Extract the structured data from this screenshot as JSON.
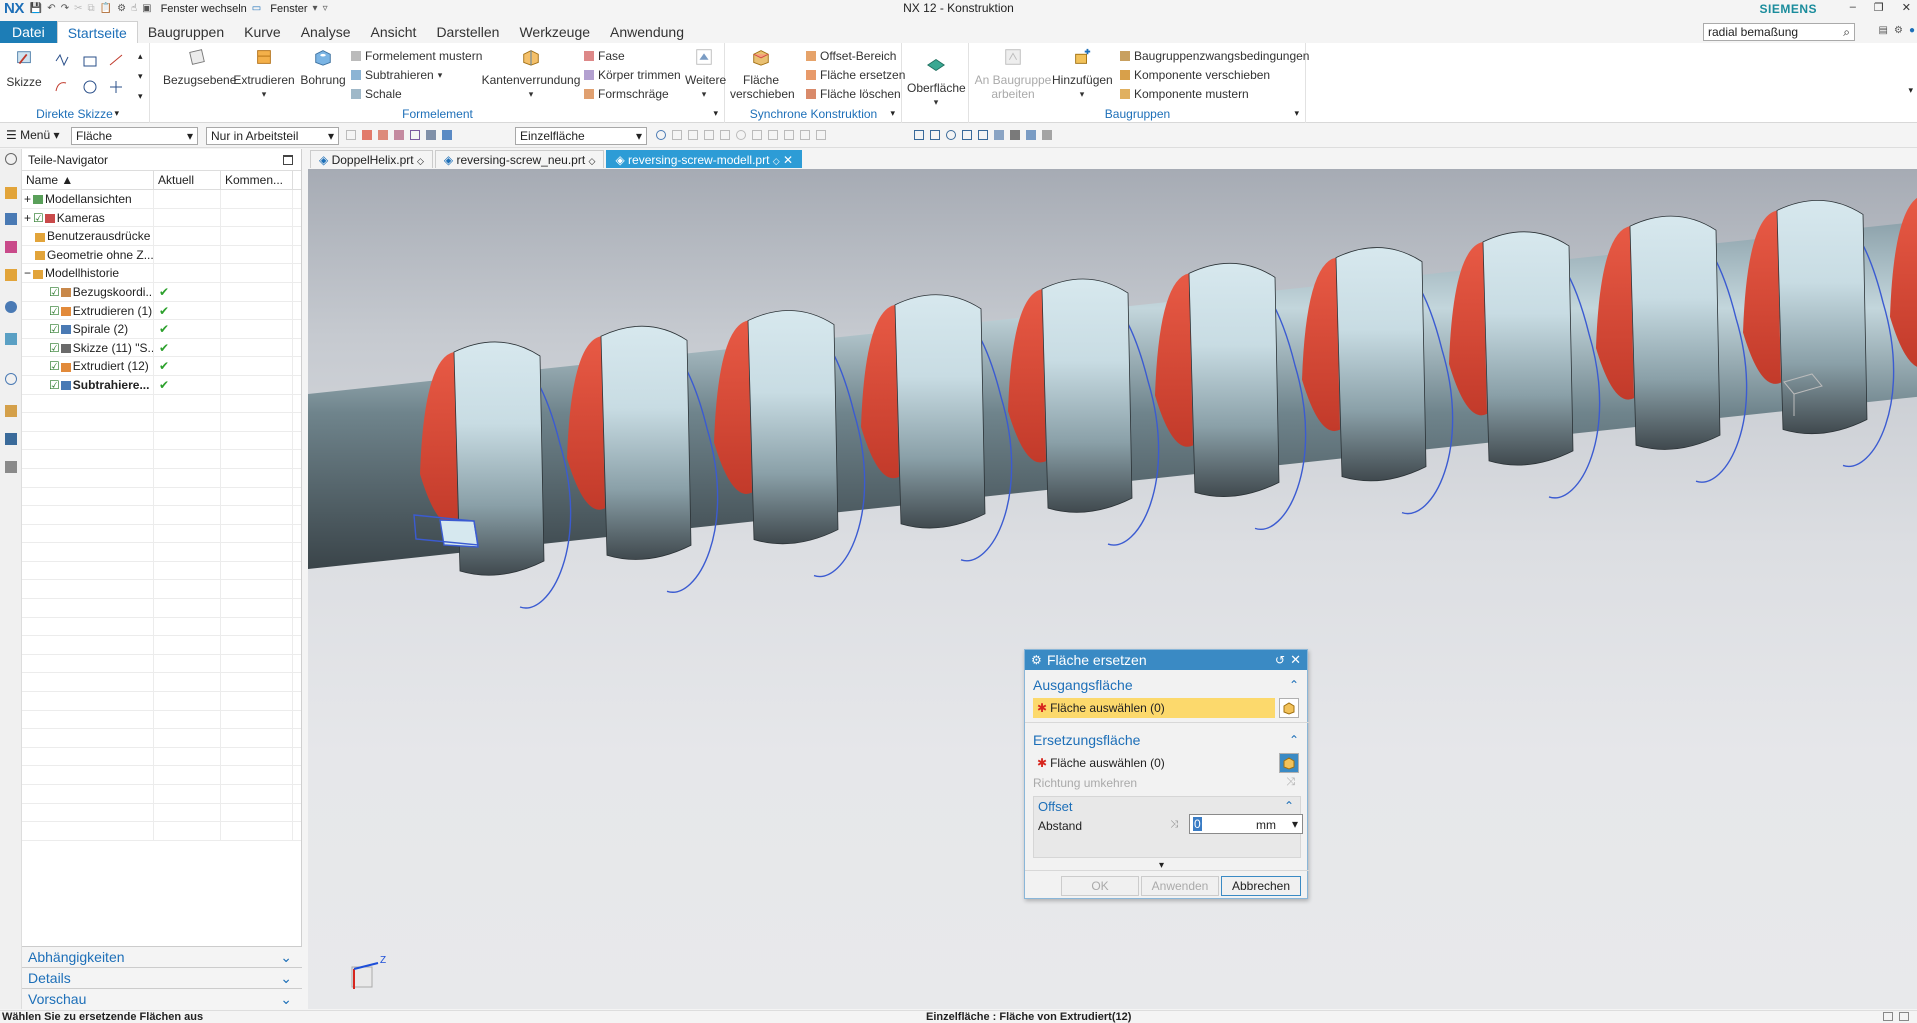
{
  "app": {
    "logo": "NX",
    "window_title": "NX 12 - Konstruktion",
    "brand": "SIEMENS",
    "quick_access": {
      "switch_window": "Fenster wechseln",
      "window": "Fenster"
    },
    "search_value": "radial bemaßung"
  },
  "ribbon_tabs": [
    "Datei",
    "Startseite",
    "Baugruppen",
    "Kurve",
    "Analyse",
    "Ansicht",
    "Darstellen",
    "Werkzeuge",
    "Anwendung"
  ],
  "ribbon": {
    "direct_sketch": {
      "label": "Direkte Skizze",
      "sketch": "Skizze"
    },
    "feature": {
      "label": "Formelement",
      "datum_plane": "Bezugsebene",
      "extrude": "Extrudieren",
      "hole": "Bohrung",
      "pattern": "Formelement mustern",
      "subtract": "Subtrahieren",
      "shell": "Schale",
      "edge_blend": "Kantenverrundung",
      "chamfer": "Fase",
      "trim_body": "Körper trimmen",
      "draft": "Formschräge",
      "more": "Weitere"
    },
    "sync": {
      "label": "Synchrone Konstruktion",
      "move_face_1": "Fläche",
      "move_face_2": "verschieben",
      "offset_region": "Offset-Bereich",
      "replace_face": "Fläche ersetzen",
      "delete_face": "Fläche löschen"
    },
    "surface": {
      "label": "Oberfläche"
    },
    "assemblies": {
      "label": "Baugruppen",
      "work_on_1": "An Baugruppe",
      "work_on_2": "arbeiten",
      "add": "Hinzufügen",
      "constraints": "Baugruppenzwangsbedingungen",
      "move_component": "Komponente verschieben",
      "pattern_component": "Komponente mustern"
    }
  },
  "toolbar": {
    "menu": "Menü",
    "filter_type": "Fläche",
    "scope": "Nur in Arbeitsteil",
    "face_rule": "Einzelfläche"
  },
  "navigator": {
    "title": "Teile-Navigator",
    "columns": [
      "Name",
      "Aktuell",
      "Kommen..."
    ],
    "rows": [
      {
        "label": "Modellansichten",
        "current": ""
      },
      {
        "label": "Kameras",
        "current": ""
      },
      {
        "label": "Benutzerausdrücke",
        "current": ""
      },
      {
        "label": "Geometrie ohne Z...",
        "current": ""
      },
      {
        "label": "Modellhistorie",
        "current": ""
      },
      {
        "label": "Bezugskoordi...",
        "current": "✔"
      },
      {
        "label": "Extrudieren (1)",
        "current": "✔"
      },
      {
        "label": "Spirale (2)",
        "current": "✔"
      },
      {
        "label": "Skizze (11) \"S...",
        "current": "✔"
      },
      {
        "label": "Extrudiert (12)",
        "current": "✔"
      },
      {
        "label": "Subtrahiere...",
        "current": "✔"
      }
    ],
    "panels": [
      "Abhängigkeiten",
      "Details",
      "Vorschau"
    ]
  },
  "doc_tabs": [
    "DoppelHelix.prt",
    "reversing-screw_neu.prt",
    "reversing-screw-modell.prt"
  ],
  "dialog": {
    "title": "Fläche ersetzen",
    "source_section": "Ausgangsfläche",
    "source_select": "Fläche auswählen (0)",
    "replacement_section": "Ersetzungsfläche",
    "replacement_select": "Fläche auswählen (0)",
    "reverse_direction": "Richtung umkehren",
    "offset_section": "Offset",
    "distance_label": "Abstand",
    "distance_value": "0",
    "distance_unit": "mm",
    "ok": "OK",
    "apply": "Anwenden",
    "cancel": "Abbrechen"
  },
  "status": {
    "prompt": "Wählen Sie zu ersetzende Flächen aus",
    "selection": "Einzelfläche : Fläche von Extrudiert(12)"
  },
  "triad": {
    "z": "Z"
  },
  "colors": {
    "accent": "#1d7db6",
    "face_highlight": "#e0473a",
    "helix": "#3b5bd1",
    "body": "#c9dce2"
  }
}
